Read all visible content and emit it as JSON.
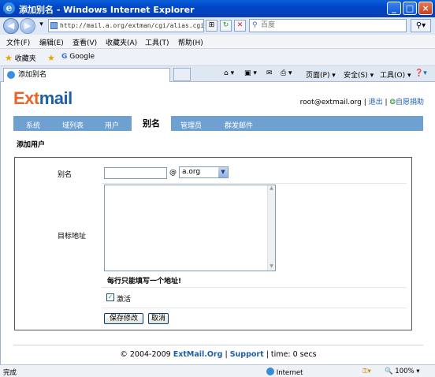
{
  "window": {
    "title": "添加别名 - Windows Internet Explorer",
    "minimize": "_",
    "maximize": "□",
    "close": "×"
  },
  "addressbar": {
    "url": "http://mail.a.org/extman/cgi/alias.cgi",
    "search_placeholder": "百度"
  },
  "menu": [
    "文件(F)",
    "编辑(E)",
    "查看(V)",
    "收藏夹(A)",
    "工具(T)",
    "帮助(H)"
  ],
  "favorites": {
    "label": "收藏夹",
    "items": [
      "Google"
    ]
  },
  "tab": {
    "label": "添加别名"
  },
  "commandbar": {
    "page": "页面(P) ▾",
    "safety": "安全(S) ▾",
    "tools": "工具(O) ▾"
  },
  "app": {
    "logo_ext": "Ext",
    "logo_mail": "mail",
    "user": "root@extmail.org",
    "logout": "退出",
    "donate": "自愿捐助",
    "nav": [
      "系统",
      "域列表",
      "用户",
      "别名",
      "管理员",
      "群发邮件"
    ],
    "active_nav": "别名",
    "section_title": "添加用户"
  },
  "form": {
    "alias_label": "别名",
    "alias_value": "",
    "at": "@",
    "domain_selected": "a.org",
    "target_label": "目标地址",
    "target_value": "",
    "hint": "每行只能填写一个地址!",
    "active_label": "激活",
    "active_checked": true,
    "save_button": "保存修改",
    "cancel_button": "取消"
  },
  "footer": {
    "copyright": "© 2004-2009",
    "brand": "ExtMail.Org",
    "sep1": "|",
    "support": "Support",
    "sep2": "|",
    "time": "time: 0 secs"
  },
  "status": {
    "left": "完成",
    "zone": "Internet",
    "zoom": "100%"
  },
  "colors": {
    "nav_bg": "#6ea0d2",
    "link": "#1f5fa8",
    "logo_orange": "#e8662a",
    "titlebar": "#0046c8"
  }
}
